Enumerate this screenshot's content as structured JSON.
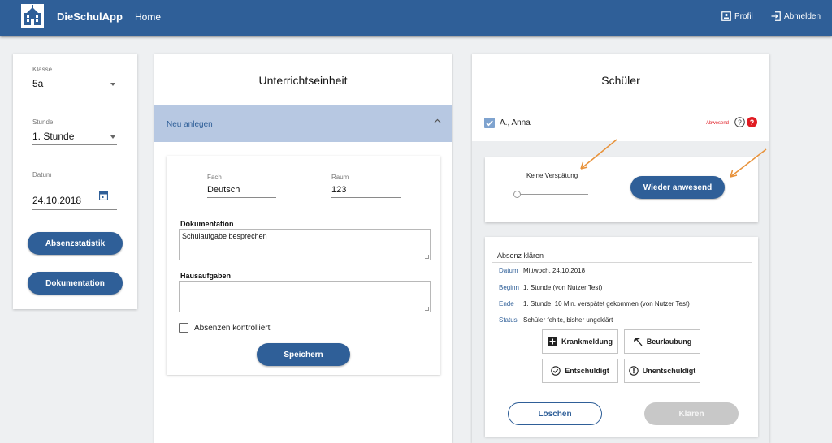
{
  "app": {
    "brand": "DieSchulApp",
    "nav_home": "Home",
    "profile": "Profil",
    "logout": "Abmelden"
  },
  "colors": {
    "primary": "#2f5f98",
    "header_band": "#b7c8e2",
    "alert": "#e01b22",
    "disabled": "#c8c8c8"
  },
  "filters": {
    "class_label": "Klasse",
    "class_value": "5a",
    "lesson_label": "Stunde",
    "lesson_value": "1. Stunde",
    "date_label": "Datum",
    "date_value": "24.10.2018",
    "absence_stats_button": "Absenzstatistik",
    "documentation_button": "Dokumentation"
  },
  "unit": {
    "title": "Unterrichtseinheit",
    "new_label": "Neu anlegen",
    "subject_label": "Fach",
    "subject_value": "Deutsch",
    "room_label": "Raum",
    "room_value": "123",
    "documentation_label": "Dokumentation",
    "documentation_value": "Schulaufgabe besprechen",
    "homework_label": "Hausaufgaben",
    "homework_value": "",
    "absences_checked_label": "Absenzen kontrolliert",
    "save_button": "Speichern"
  },
  "students": {
    "title": "Schüler",
    "student_name": "A., Anna",
    "status_text": "Abwesend",
    "late_label": "Keine Verspätung",
    "late_slider_value": 0,
    "present_again_button": "Wieder anwesend",
    "resolve": {
      "title": "Absenz klären",
      "rows": [
        {
          "label": "Datum",
          "value": "Mittwoch, 24.10.2018"
        },
        {
          "label": "Beginn",
          "value": "1. Stunde (von Nutzer Test)"
        },
        {
          "label": "Ende",
          "value": "1. Stunde, 10 Min. verspätet gekommen (von Nutzer Test)"
        },
        {
          "label": "Status",
          "value": "Schüler fehlte, bisher ungeklärt"
        }
      ],
      "sick_note": "Krankmeldung",
      "leave": "Beurlaubung",
      "excused": "Entschuldigt",
      "unexcused": "Unentschuldigt",
      "delete_button": "Löschen",
      "resolve_button": "Klären"
    }
  }
}
